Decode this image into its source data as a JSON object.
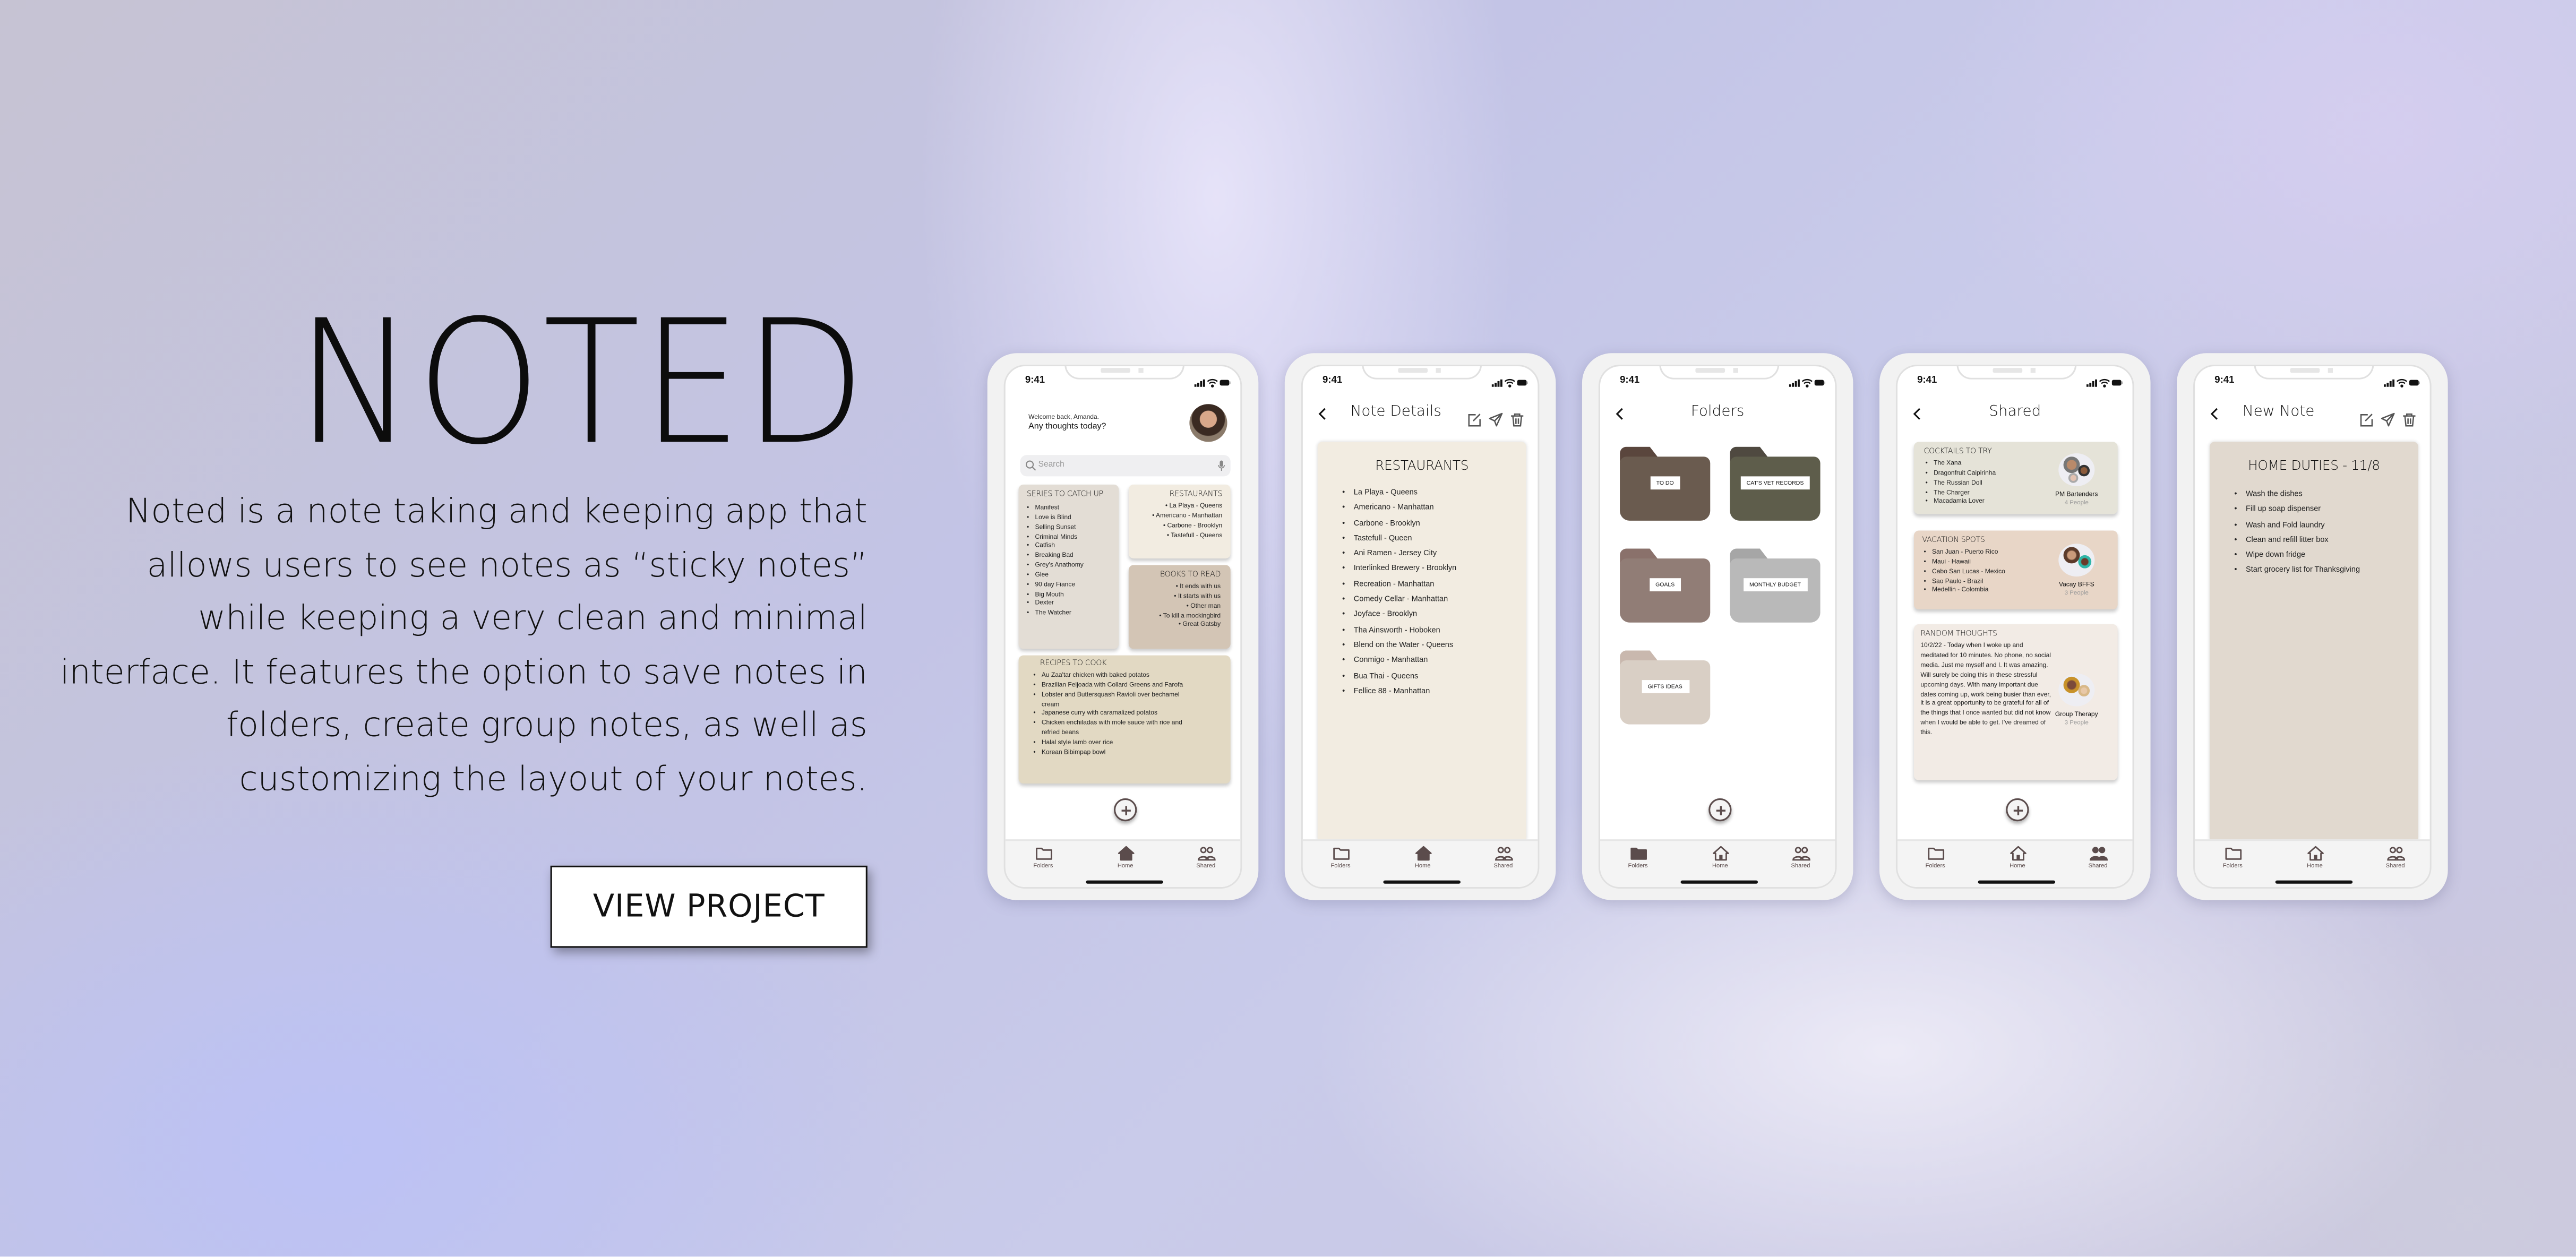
{
  "hero": {
    "title": "NOTED",
    "description_lines": [
      "Noted is a note taking and keeping app that",
      "allows users to see notes as “sticky notes”",
      "while keeping a very clean and minimal",
      "interface. It features the option to save notes in",
      "folders, create group notes, as well as",
      "customizing the layout of your notes."
    ],
    "cta": "VIEW PROJECT"
  },
  "status": {
    "time": "9:41"
  },
  "tabbar": {
    "folders": "Folders",
    "home": "Home",
    "shared": "Shared"
  },
  "home": {
    "welcome": "Welcome back, Amanda.",
    "prompt": "Any thoughts today?",
    "search_placeholder": "Search",
    "notes": [
      {
        "title": "SERIES TO CATCH UP",
        "items": [
          "Manifest",
          "Love is Blind",
          "Selling Sunset",
          "Criminal Minds",
          "Catfish",
          "Breaking Bad",
          "Grey's Anathomy",
          "Glee",
          "90 day Fiance",
          "Big Mouth",
          "Dexter",
          "The Watcher"
        ],
        "color": "#e3ddd5"
      },
      {
        "title": "RESTAURANTS",
        "items": [
          "La Playa - Queens",
          "Americano - Manhattan",
          "Carbone - Brooklyn",
          "Tastefull - Queens"
        ],
        "color": "#f2ece1"
      },
      {
        "title": "BOOKS TO READ",
        "items": [
          "It ends with us",
          "It starts with us",
          "Other man",
          "To kill a mockingbird",
          "Great Gatsby"
        ],
        "color": "#d3c5b5"
      },
      {
        "title": "RECIPES TO COOK",
        "items": [
          "Au Zaa'tar chicken with baked potatos",
          "Brazilian Feijoada with Collard Greens and Farofa",
          "Lobster and Buttersquash Ravioli over bechamel cream",
          "Japanese curry with caramalized potatos",
          "Chicken enchiladas with mole sauce with rice and refried beans",
          "Halal style lamb over rice",
          "Korean Bibimpap bowl"
        ],
        "color": "#e2d9c3"
      }
    ]
  },
  "note_details": {
    "title": "Note Details",
    "note_title": "RESTAURANTS",
    "items": [
      "La Playa - Queens",
      "Americano - Manhattan",
      "Carbone - Brooklyn",
      "Tastefull - Queen",
      "Ani Ramen - Jersey City",
      "Interlinked Brewery - Brooklyn",
      "Recreation - Manhattan",
      "Comedy Cellar - Manhattan",
      "Joyface - Brooklyn",
      "Tha Ainsworth - Hoboken",
      "Blend on the Water - Queens",
      "Conmigo - Manhattan",
      "Bua Thai - Queens",
      "Fellice 88 - Manhattan"
    ],
    "color": "#f2ece1"
  },
  "folders": {
    "title": "Folders",
    "items": [
      {
        "label": "TO DO",
        "color": "#6a5b4f",
        "tab_color": "#5a463d"
      },
      {
        "label": "CAT'S VET RECORDS",
        "color": "#5e5d4b",
        "tab_color": "#4f4940"
      },
      {
        "label": "GOALS",
        "color": "#917d76",
        "tab_color": "#8a716b"
      },
      {
        "label": "MONTHLY BUDGET",
        "color": "#b9b9b9",
        "tab_color": "#a6a6a6"
      },
      {
        "label": "GIFTS IDEAS",
        "color": "#d9cfc5",
        "tab_color": "#c9b8ae"
      }
    ]
  },
  "shared": {
    "title": "Shared",
    "notes": [
      {
        "title": "COCKTAILS TO TRY",
        "items": [
          "The Xana",
          "Dragonfruit Caipirinha",
          "The Russian Doll",
          "The Charger",
          "Macadamia Lover"
        ],
        "group": "PM Bartenders",
        "people": "4 People",
        "color": "#e5e3d8"
      },
      {
        "title": "VACATION SPOTS",
        "items": [
          "San Juan - Puerto Rico",
          "Maui - Hawaii",
          "Cabo San Lucas - Mexico",
          "Sao Paulo - Brazil",
          "Medellin - Colombia"
        ],
        "group": "Vacay BFFS",
        "people": "3 People",
        "color": "#e8d6c7"
      },
      {
        "title": "RANDOM THOUGHTS",
        "body": "10/2/22 - Today when I woke up and meditated for 10 minutes. No phone, no social media. Just me myself and I. It was amazing. Will surely be doing this in these stressful upcoming days. With many important due dates coming up, work being busier than ever, it is a great opportunity to be grateful for all of the things that I once wanted but did not know when I would be able to get. I've dreamed of this.",
        "group": "Group Therapy",
        "people": "3 People",
        "color": "#f2ebe5"
      }
    ]
  },
  "new_note": {
    "title": "New Note",
    "note_title": "HOME DUTIES - 11/8",
    "items": [
      "Wash the dishes",
      "Fill up soap dispenser",
      "Wash and Fold laundry",
      "Clean and refill litter box",
      "Wipe down fridge",
      "Start grocery list for Thanksgiving"
    ],
    "color": "#e1d9cf"
  },
  "colors": {
    "icon": "#5b4c4c",
    "accent_text": "#111111"
  }
}
